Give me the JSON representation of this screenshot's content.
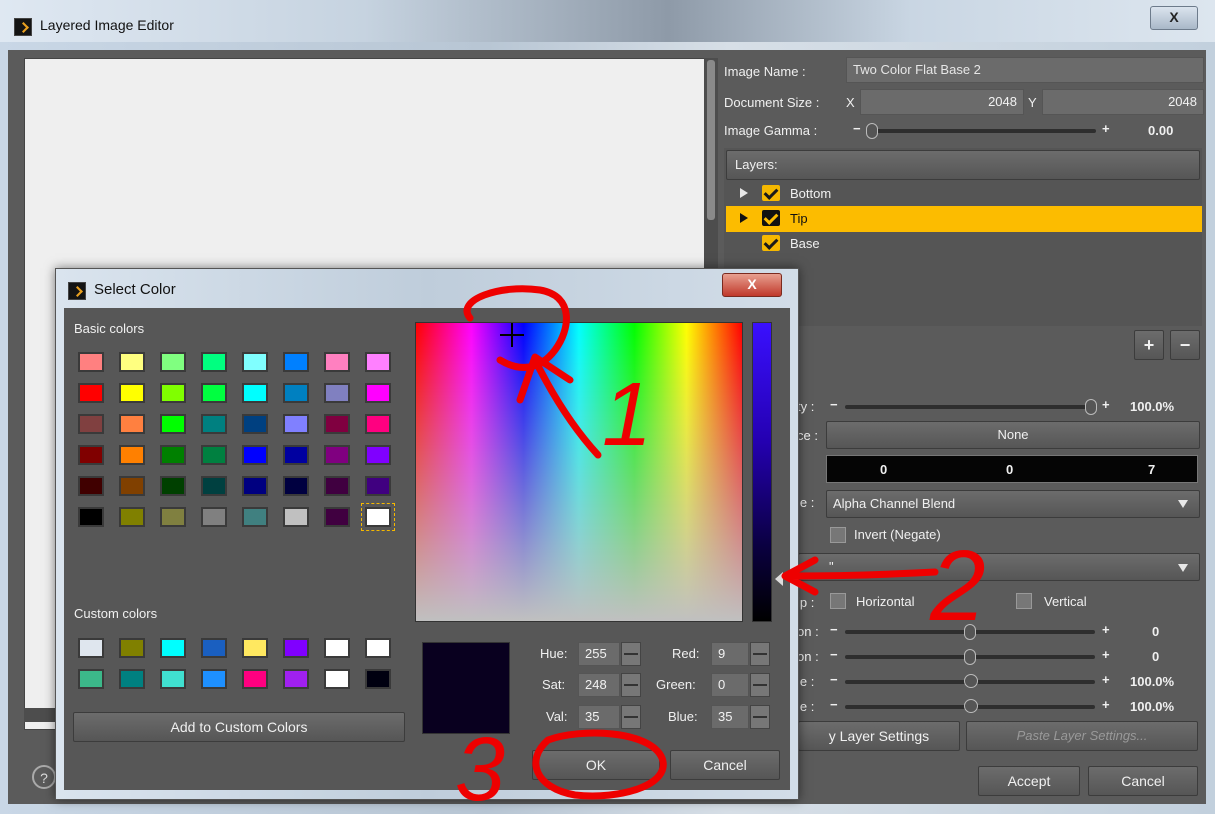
{
  "main_window": {
    "title": "Layered Image Editor",
    "close_label": "X",
    "help_label": "?"
  },
  "image_props": {
    "name_label": "Image Name :",
    "name_value": "Two Color Flat Base 2",
    "doc_size_label": "Document Size :",
    "x_label": "X",
    "x_value": "2048",
    "y_label": "Y",
    "y_value": "2048",
    "gamma_label": "Image Gamma :",
    "gamma_value": "0.00"
  },
  "layers": {
    "header": "Layers:",
    "items": [
      {
        "label": "Bottom",
        "selected": false
      },
      {
        "label": "Tip",
        "selected": true
      },
      {
        "label": "Base",
        "selected": false
      }
    ],
    "add_label": "+",
    "remove_label": "−"
  },
  "layer_settings": {
    "opacity_label_partial": "ty :",
    "opacity_value": "100.0%",
    "source_label_partial": "ce :",
    "source_value": "None",
    "color_r": "0",
    "color_g": "0",
    "color_b": "7",
    "blend_label_partial": "le :",
    "blend_value": "Alpha Channel Blend",
    "invert_label": "Invert (Negate)",
    "mode_partial": "\"",
    "flip_label_partial": "ip :",
    "horizontal_label": "Horizontal",
    "vertical_label": "Vertical",
    "rot_label_partial": "on :",
    "rot_value": "0",
    "rot2_label_partial": "on :",
    "rot2_value": "0",
    "scale_label_partial": "le :",
    "scale_value": "100.0%",
    "scale2_label_partial": "le :",
    "scale2_value": "100.0%",
    "copy_label_partial": "y Layer Settings",
    "paste_label": "Paste Layer Settings..."
  },
  "footer": {
    "accept_label": "Accept",
    "cancel_label": "Cancel"
  },
  "select_color": {
    "title": "Select Color",
    "close_label": "X",
    "basic_colors_label": "Basic colors",
    "basic_colors": [
      "#ff8080",
      "#ffff80",
      "#80ff80",
      "#00ff80",
      "#80ffff",
      "#0080ff",
      "#ff80c0",
      "#ff80ff",
      "#ff0000",
      "#ffff00",
      "#80ff00",
      "#00ff40",
      "#00ffff",
      "#0080c0",
      "#8080c0",
      "#ff00ff",
      "#804040",
      "#ff8040",
      "#00ff00",
      "#008080",
      "#004080",
      "#8080ff",
      "#800040",
      "#ff0080",
      "#800000",
      "#ff8000",
      "#008000",
      "#008040",
      "#0000ff",
      "#0000a0",
      "#800080",
      "#8000ff",
      "#400000",
      "#804000",
      "#004000",
      "#004040",
      "#000080",
      "#000040",
      "#400040",
      "#400080",
      "#000000",
      "#808000",
      "#808040",
      "#808080",
      "#408080",
      "#c0c0c0",
      "#400040",
      "#ffffff"
    ],
    "custom_colors_label": "Custom colors",
    "custom_colors": [
      "#dfe6ee",
      "#808000",
      "#00ffff",
      "#1a5fc0",
      "#ffe860",
      "#8000ff",
      "#ffffff",
      "#ffffff",
      "#3cb88a",
      "#008080",
      "#40e0d0",
      "#1e90ff",
      "#ff0080",
      "#a020f0",
      "#ffffff",
      "#000010"
    ],
    "add_custom_label": "Add to Custom Colors",
    "current_color": "#09001f",
    "hue_label": "Hue:",
    "hue_value": "255",
    "sat_label": "Sat:",
    "sat_value": "248",
    "val_label": "Val:",
    "val_value": "35",
    "red_label": "Red:",
    "red_value": "9",
    "green_label": "Green:",
    "green_value": "0",
    "blue_label": "Blue:",
    "blue_value": "35",
    "ok_label": "OK",
    "cancel_label": "Cancel"
  },
  "annotations": {
    "mark_1": "1",
    "mark_2": "2",
    "mark_3": "3",
    "color": "#ee0000"
  }
}
